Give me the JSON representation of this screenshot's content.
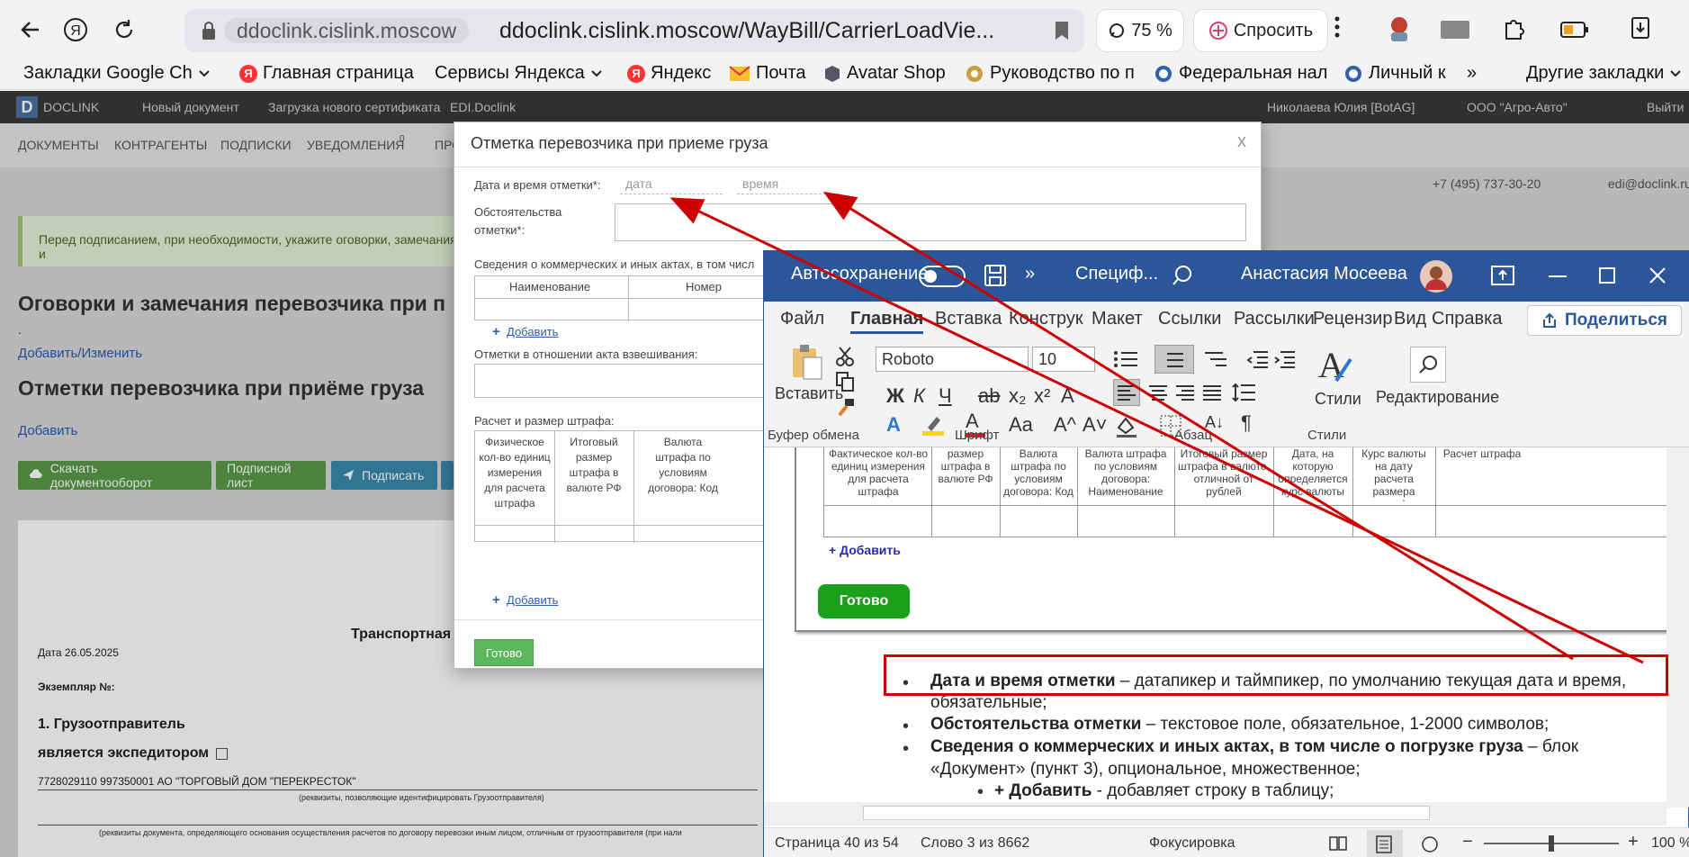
{
  "browser": {
    "domain_chip": "ddoclink.cislink.moscow",
    "url": "ddoclink.cislink.moscow/WayBill/CarrierLoadVie...",
    "zoom": "75 %",
    "ask": "Спросить"
  },
  "bookmarks": [
    {
      "label": "Закладки Google Ch"
    },
    {
      "label": "Главная страница"
    },
    {
      "label": "Сервисы Яндекса"
    },
    {
      "label": "Яндекс"
    },
    {
      "label": "Почта"
    },
    {
      "label": "Avatar Shop"
    },
    {
      "label": "Руководство по п"
    },
    {
      "label": "Федеральная нал"
    },
    {
      "label": "Личный к"
    },
    {
      "label": "»"
    },
    {
      "label": "Другие закладки"
    }
  ],
  "doclink": {
    "logo": "D",
    "brand": "DOCLINK",
    "new_doc": "Новый документ",
    "cert": "Загрузка нового сертификата",
    "edi": "EDI.Doclink",
    "user": "Николаева Юлия [BotAG]",
    "org": "ООО \"Агро-Авто\"",
    "exit": "Выйти",
    "nav": [
      "ДОКУМЕНТЫ",
      "КОНТРАГЕНТЫ",
      "ПОДПИСКИ",
      "УВЕДОМЛЕНИЯ",
      "ПРО"
    ],
    "notif_count": "0",
    "phone": "+7 (495) 737-30-20",
    "email": "edi@doclink.ru",
    "notice": "Перед подписанием, при необходимости, укажите оговорки, замечания и",
    "h_remarks": "Оговорки и замечания перевозчика при п",
    "dot": ".",
    "add_edit": "Добавить/Изменить",
    "h_marks": "Отметки перевозчика при приёме груза",
    "add": "Добавить",
    "btns": [
      "Скачать документооборот",
      "Подписной лист",
      "Подписать"
    ],
    "doc_title": "Транспортная н",
    "date": "Дата  26.05.2025",
    "copy": "Экземпляр №:",
    "shipper": "1. Грузоотправитель",
    "forwarder": "является экспедитором",
    "inn": "7728029110 997350001 АО \"ТОРГОВЫЙ ДОМ \"ПЕРЕКРЕСТОК\"",
    "rekv": "(реквизиты, позволяющие идентифицировать Грузоотправителя)",
    "rekv2": "(реквизиты документа, определяющего основания осуществления расчетов по договору перевозки иным лицом, отличным от грузоотправителя (при нали"
  },
  "modal": {
    "title": "Отметка перевозчика при приеме груза",
    "close": "x",
    "dt_label": "Дата и время отметки*:",
    "date_ph": "дата",
    "time_ph": "время",
    "circ_label_1": "Обстоятельства",
    "circ_label_2": "отметки*:",
    "acts_label": "Сведения о коммерческих и иных актах, в том числ",
    "acts_cols": [
      "Наименование",
      "Номер"
    ],
    "add": "Добавить",
    "weigh_label": "Отметки в отношении акта взвешивания:",
    "fine_label": "Расчет и размер штрафа:",
    "fine_cols": [
      [
        "Физическое",
        "кол-во единиц",
        "измерения",
        "для расчета",
        "штрафа"
      ],
      [
        "Итоговый",
        "размер",
        "штрафа в",
        "валюте РФ"
      ],
      [
        "Валюта",
        "штрафа по",
        "условиям",
        "договора: Код"
      ]
    ],
    "done": "Готово"
  },
  "word": {
    "autosave": "Автосохранение",
    "doc_name": "Специф...",
    "user": "Анастасия Мосеева",
    "tabs": [
      "Файл",
      "Главная",
      "Вставка",
      "Конструк",
      "Макет",
      "Ссылки",
      "Рассылки",
      "Рецензир",
      "Вид",
      "Справка"
    ],
    "share": "Поделиться",
    "paste": "Вставить",
    "font": "Roboto",
    "size": "10",
    "groups": [
      "Буфер обмена",
      "Шрифт",
      "Абзац",
      "Стили"
    ],
    "styles": "Стили",
    "editing": "Редактирование",
    "embed_cols": [
      "Фактическое кол-во единиц измерения для расчета штрафа",
      "размер штрафа в валюте РФ",
      "Валюта штрафа по условиям договора: Код",
      "Валюта штрафа по условиям договора: Наименование",
      "Итоговый размер штрафа в валюте, отличной от рублей",
      "Дата, на которую определяется курс валюты",
      "Курс валюты на дату расчета размера штрафа",
      "Расчет штрафа"
    ],
    "embed_add": "+ Добавить",
    "embed_done": "Готово",
    "bullets": [
      {
        "bold": "Дата и время отметки",
        "rest": " – датапикер и таймпикер, по умолчанию текущая дата и время,"
      },
      {
        "bold": "",
        "rest": "обязательные;"
      },
      {
        "bold": "Обстоятельства отметки",
        "rest": " – текстовое поле, обязательное, 1-2000 символов;"
      },
      {
        "bold": "Сведения о коммерческих и иных актах, в том числе о погрузке груза",
        "rest": " – блок"
      },
      {
        "bold": "",
        "rest": "«Документ» (пункт 3), опциональное, множественное;"
      },
      {
        "bold": "+ Добавить",
        "rest": " - добавляет строку в таблицу;"
      }
    ],
    "status": {
      "page": "Страница 40 из 54",
      "words": "Слово 3 из 8662",
      "focus": "Фокусировка",
      "zoom": "100 %"
    }
  }
}
